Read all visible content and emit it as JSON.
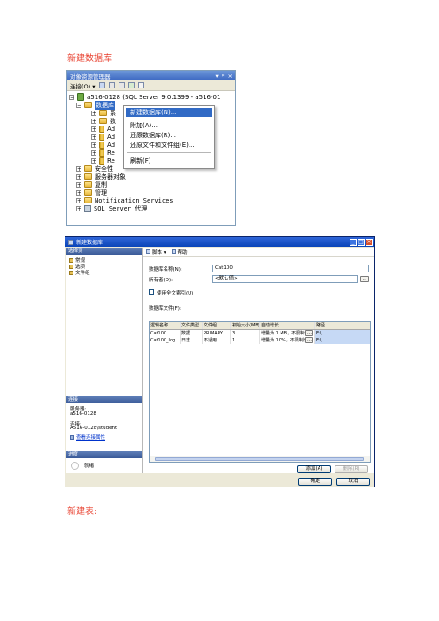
{
  "doc": {
    "caption_top": "新建数据库",
    "caption_bottom": "新建表:"
  },
  "object_explorer": {
    "title": "对象资源管理器",
    "title_controls": [
      "▾",
      "ᵖ",
      "×"
    ],
    "toolbar_connect": "连接(O) ▾",
    "server_node": "a516-0128 (SQL Server 9.0.1399 - a516-01",
    "databases_node": "数据库",
    "child_stubs": [
      "系",
      "数",
      "Ad",
      "Ad",
      "Ad",
      "Re",
      "Re"
    ],
    "other_nodes": [
      "安全性",
      "服务器对象",
      "复制",
      "管理",
      "Notification Services",
      "SQL Server 代理"
    ]
  },
  "context_menu": {
    "items": [
      "新建数据库(N)...",
      "附加(A)...",
      "还原数据库(R)...",
      "还原文件和文件组(E)...",
      "刷新(F)"
    ],
    "highlighted_index": 0
  },
  "new_db_dialog": {
    "title": "新建数据库",
    "left": {
      "select_page_header": "选择页",
      "pages": [
        "常规",
        "选项",
        "文件组"
      ],
      "connection_header": "连接",
      "server_label": "服务器:",
      "server_value": "a516-0128",
      "connection_label": "连接:",
      "connection_value": "A516-0128\\student",
      "view_conn_link": "查看连接属性",
      "progress_header": "进度",
      "progress_status": "就绪"
    },
    "toolbar": {
      "script": "脚本 ▾",
      "help": "帮助"
    },
    "db_name_label": "数据库名称(N):",
    "db_name_value": "Cat100",
    "owner_label": "所有者(O):",
    "owner_value": "<默认值>",
    "fulltext_label": "使用全文索引(U)",
    "files_label": "数据库文件(F):",
    "grid_headers": [
      "逻辑名称",
      "文件类型",
      "文件组",
      "初始大小(MB)",
      "自动增长",
      "路径"
    ],
    "grid_rows": [
      [
        "Cat100",
        "数据",
        "PRIMARY",
        "3",
        "增量为 1 MB，不限制增长",
        "E:\\"
      ],
      [
        "Cat100_log",
        "日志",
        "不适用",
        "1",
        "增量为 10%，不限制增长",
        "E:\\"
      ]
    ],
    "add_button": "添加(A)",
    "remove_button": "删除(R)",
    "ok_button": "确定",
    "cancel_button": "取消"
  }
}
